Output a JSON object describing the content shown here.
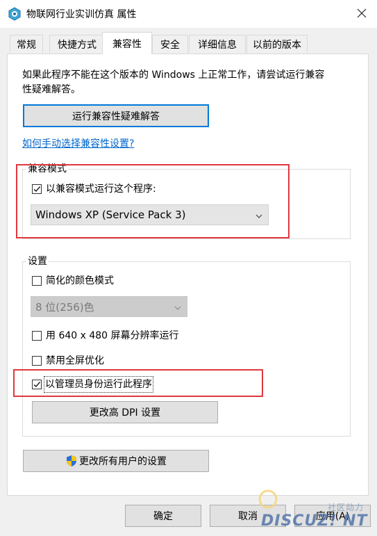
{
  "window": {
    "title": "物联网行业实训仿真 属性",
    "close_icon": "close-icon"
  },
  "tabs": [
    {
      "label": "常规"
    },
    {
      "label": "快捷方式"
    },
    {
      "label": "兼容性"
    },
    {
      "label": "安全"
    },
    {
      "label": "详细信息"
    },
    {
      "label": "以前的版本"
    }
  ],
  "active_tab": "兼容性",
  "intro_text_line1": "如果此程序不能在这个版本的 Windows 上正常工作，请尝试运行兼容",
  "intro_text_line2": "性疑难解答。",
  "run_troubleshooter_label": "运行兼容性疑难解答",
  "manual_link_label": "如何手动选择兼容性设置?",
  "compat_mode": {
    "group_label": "兼容模式",
    "checkbox_label": "以兼容模式运行这个程序:",
    "checked": true,
    "selected_os": "Windows XP (Service Pack 3)"
  },
  "settings": {
    "group_label": "设置",
    "reduced_color": {
      "label": "简化的颜色模式",
      "checked": false
    },
    "color_select": "8 位(256)色",
    "res_640": {
      "label": "用 640 x 480 屏幕分辨率运行",
      "checked": false
    },
    "disable_fullscreen": {
      "label": "禁用全屏优化",
      "checked": false
    },
    "run_as_admin": {
      "label": "以管理员身份运行此程序",
      "checked": true
    },
    "high_dpi_label": "更改高 DPI 设置"
  },
  "all_users_label": "更改所有用户的设置",
  "footer": {
    "ok": "确定",
    "cancel": "取消",
    "apply": "应用(A)"
  },
  "watermark": {
    "top": "社区动力",
    "brand": "DISCUZ! NT"
  },
  "colors": {
    "accent": "#0078d7",
    "highlight_red": "#e0383e",
    "link": "#0066cc"
  }
}
